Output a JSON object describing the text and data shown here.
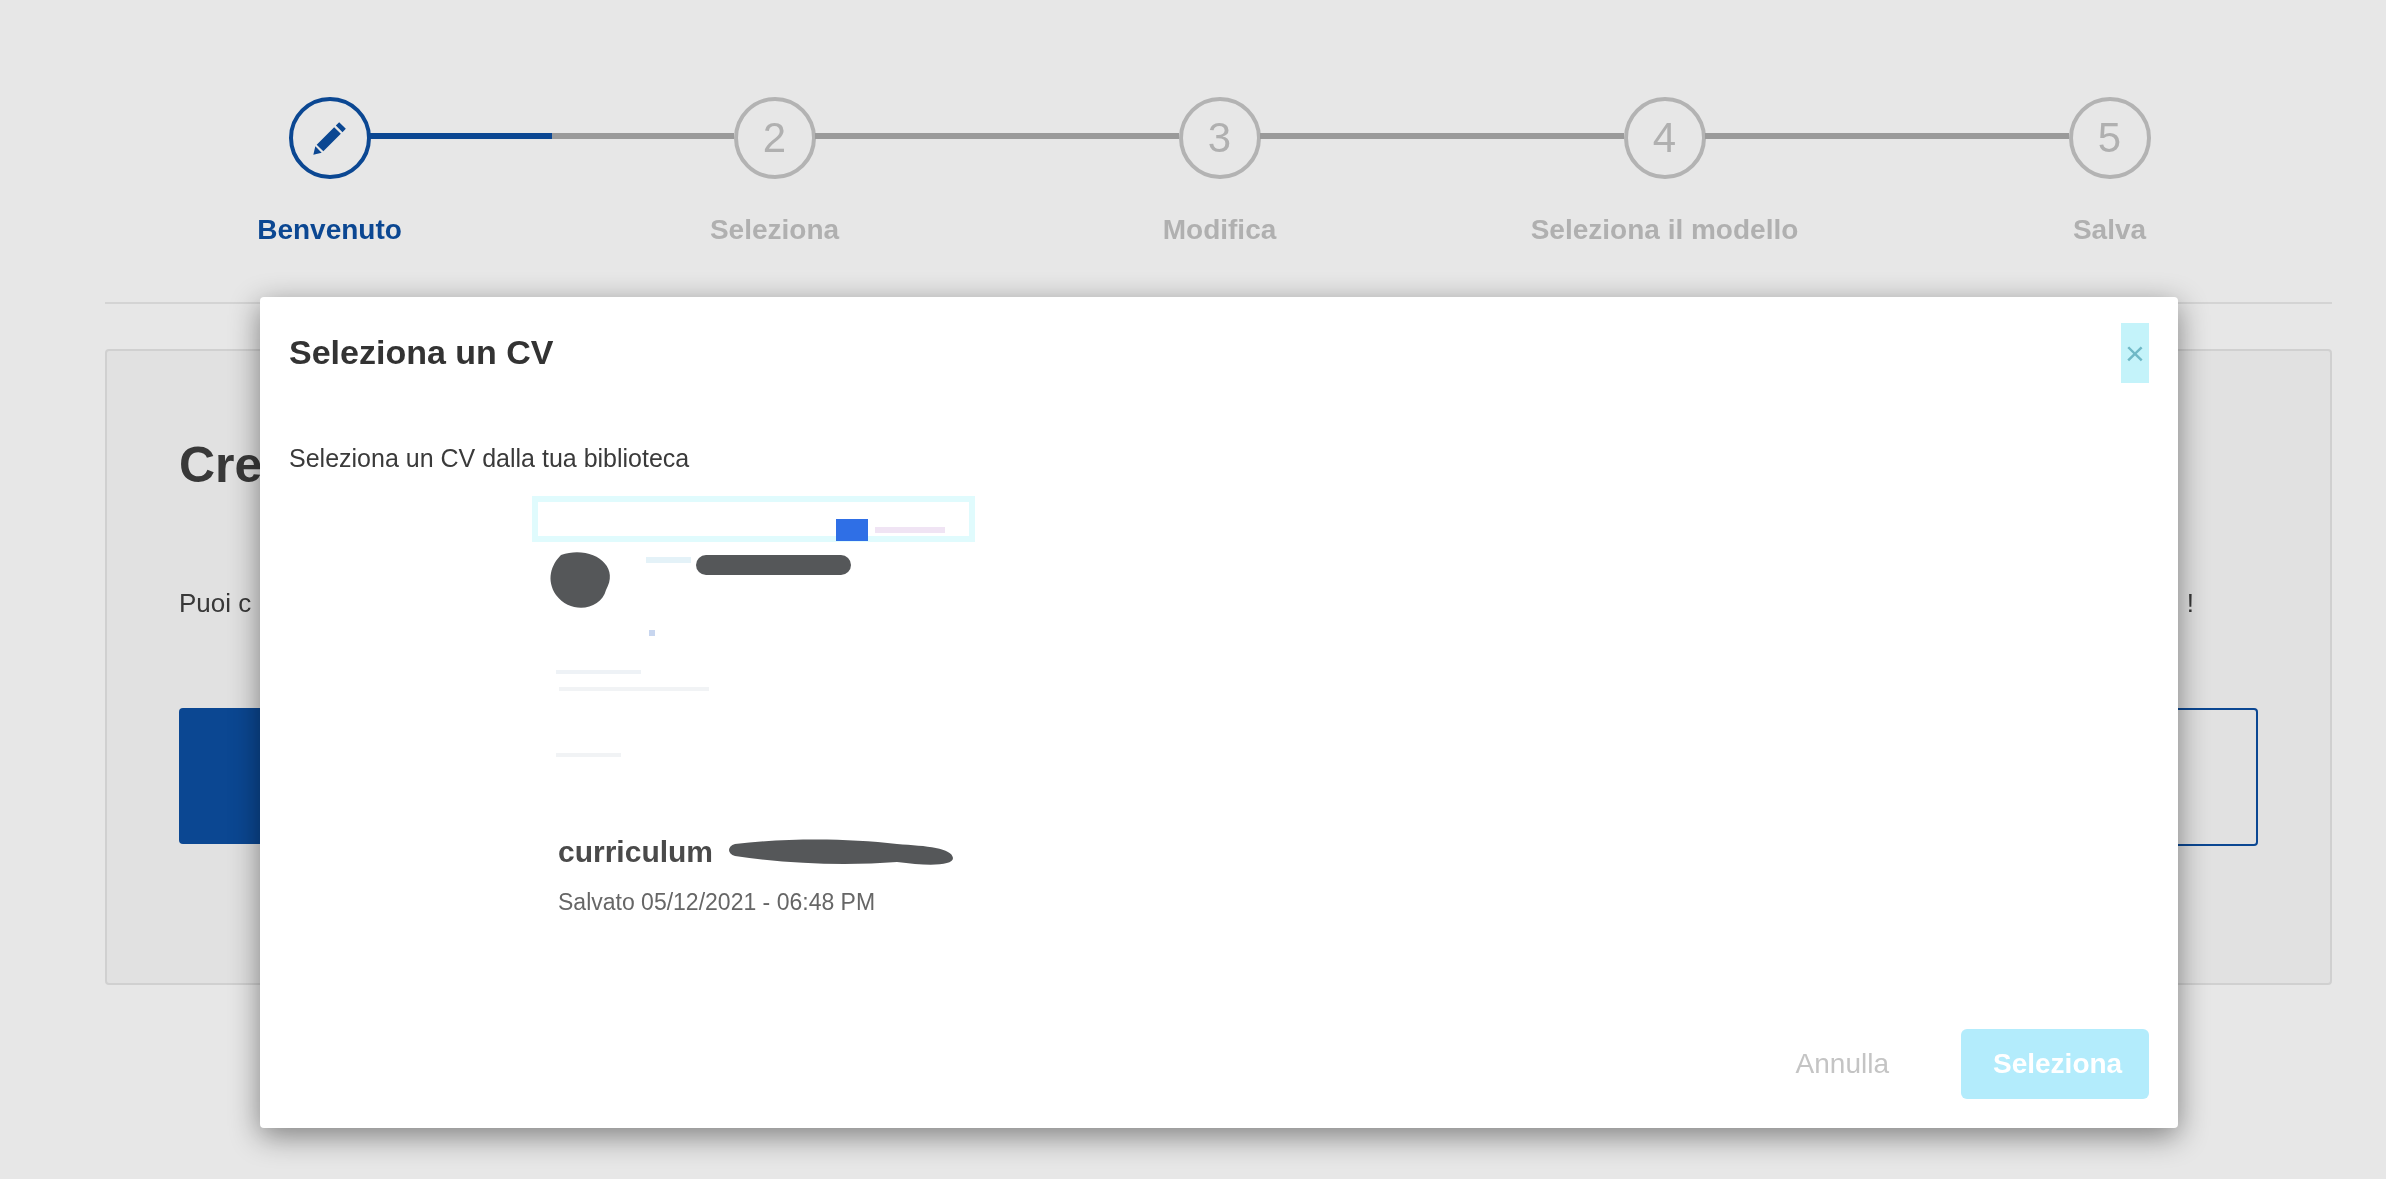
{
  "stepper": {
    "connectors": [
      {
        "level": 0.5
      }
    ],
    "steps": [
      {
        "label": "Benvenuto",
        "selected": true
      },
      {
        "label": "Seleziona",
        "number": "2",
        "selected": false
      },
      {
        "label": "Modifica",
        "number": "3",
        "selected": false
      },
      {
        "label": "Seleziona il modello",
        "number": "4",
        "selected": false
      },
      {
        "label": "Salva",
        "number": "5",
        "selected": false
      }
    ]
  },
  "card": {
    "heading": "Cre",
    "text_start": "Puoi c",
    "text_end": "!"
  },
  "dialog": {
    "title": "Seleziona un CV",
    "close": "×",
    "subtitle": "Seleziona un CV dalla tua biblioteca",
    "cv": {
      "kind": "picture",
      "name": "curriculum",
      "saved": "Salvato 05/12/2021 - 06:48 PM"
    },
    "buttons": [
      {
        "label": "Annulla",
        "kind": "text",
        "disabled": true
      },
      {
        "label": "Seleziona",
        "kind": "primary",
        "disabled": true
      }
    ]
  }
}
